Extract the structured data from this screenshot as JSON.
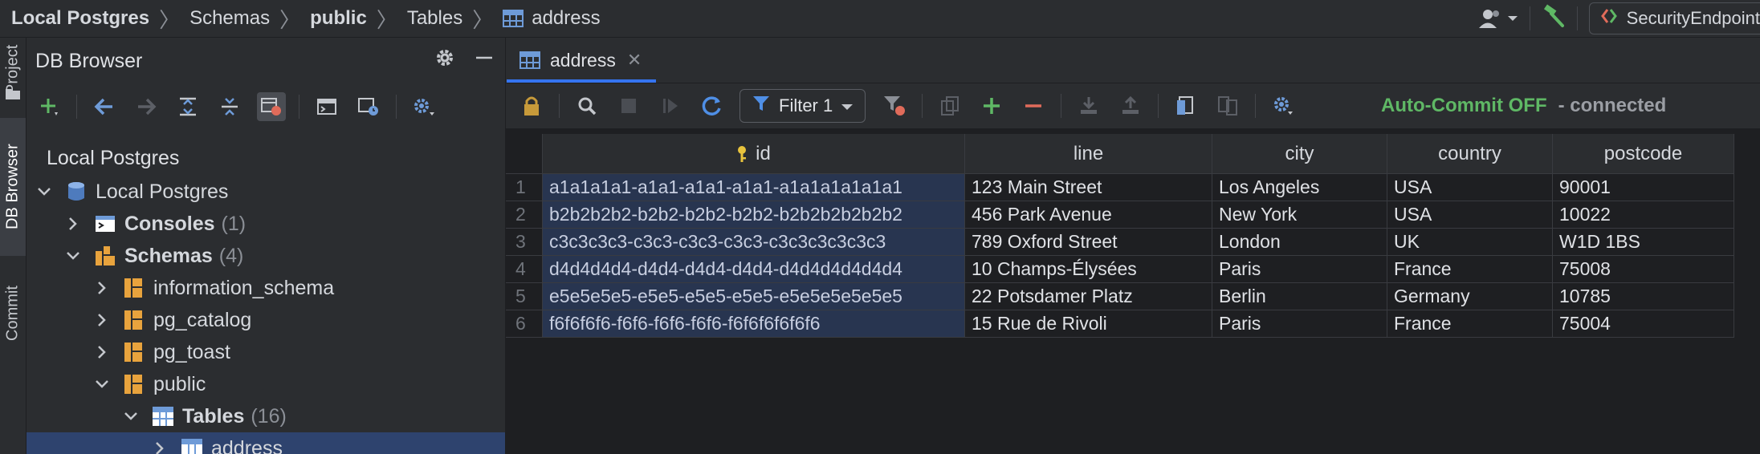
{
  "breadcrumb": {
    "items": [
      {
        "label": "Local Postgres",
        "bold": true
      },
      {
        "label": "Schemas",
        "bold": false
      },
      {
        "label": "public",
        "bold": true
      },
      {
        "label": "Tables",
        "bold": false
      },
      {
        "label": "address",
        "bold": false
      }
    ]
  },
  "header_right": {
    "run_config_label": "SecurityEndpoint"
  },
  "side_strip": {
    "project": "Project",
    "db_browser": "DB Browser",
    "commit": "Commit"
  },
  "db_browser": {
    "title": "DB Browser",
    "connection_label": "Local Postgres",
    "tree": [
      {
        "label": "Local Postgres",
        "count": ""
      },
      {
        "label": "Consoles",
        "count": "(1)"
      },
      {
        "label": "Schemas",
        "count": "(4)"
      },
      {
        "label": "information_schema",
        "count": ""
      },
      {
        "label": "pg_catalog",
        "count": ""
      },
      {
        "label": "pg_toast",
        "count": ""
      },
      {
        "label": "public",
        "count": ""
      },
      {
        "label": "Tables",
        "count": "(16)"
      },
      {
        "label": "address",
        "count": ""
      }
    ]
  },
  "editor": {
    "tab_label": "address",
    "filter_label": "Filter 1",
    "autocommit_label": "Auto-Commit OFF",
    "connection_status": "- connected"
  },
  "grid": {
    "columns": [
      "id",
      "line",
      "city",
      "country",
      "postcode"
    ],
    "rows": [
      {
        "n": "1",
        "id": "a1a1a1a1-a1a1-a1a1-a1a1-a1a1a1a1a1a1",
        "line": "123 Main Street",
        "city": "Los Angeles",
        "country": "USA",
        "postcode": "90001"
      },
      {
        "n": "2",
        "id": "b2b2b2b2-b2b2-b2b2-b2b2-b2b2b2b2b2b2",
        "line": "456 Park Avenue",
        "city": "New York",
        "country": "USA",
        "postcode": "10022"
      },
      {
        "n": "3",
        "id": "c3c3c3c3-c3c3-c3c3-c3c3-c3c3c3c3c3c3",
        "line": "789 Oxford Street",
        "city": "London",
        "country": "UK",
        "postcode": "W1D 1BS"
      },
      {
        "n": "4",
        "id": "d4d4d4d4-d4d4-d4d4-d4d4-d4d4d4d4d4d4",
        "line": "10 Champs-Élysées",
        "city": "Paris",
        "country": "France",
        "postcode": "75008"
      },
      {
        "n": "5",
        "id": "e5e5e5e5-e5e5-e5e5-e5e5-e5e5e5e5e5e5",
        "line": "22 Potsdamer Platz",
        "city": "Berlin",
        "country": "Germany",
        "postcode": "10785"
      },
      {
        "n": "6",
        "id": "f6f6f6f6-f6f6-f6f6-f6f6-f6f6f6f6f6f6",
        "line": "15 Rue de Rivoli",
        "city": "Paris",
        "country": "France",
        "postcode": "75004"
      }
    ]
  },
  "colors": {
    "accent": "#3574f0",
    "autocommit": "#5fb865",
    "add_icon": "#5fb865",
    "remove_icon": "#e06b5a",
    "folder_icon": "#e8a33d",
    "table_icon": "#6e9bd8"
  }
}
